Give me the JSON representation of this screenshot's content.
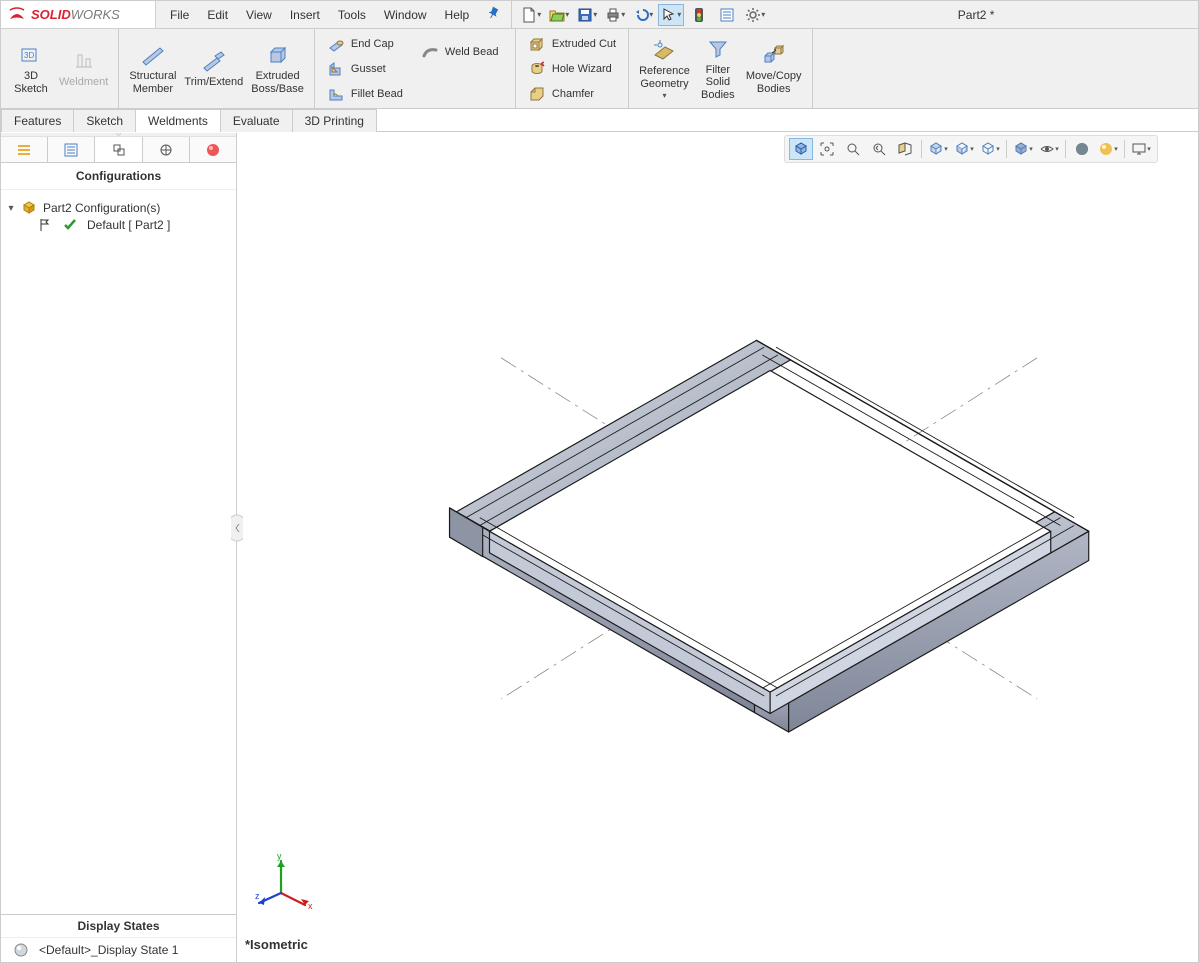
{
  "app": {
    "brand1": "SOLID",
    "brand2": "WORKS",
    "title": "Part2 *"
  },
  "menu": {
    "items": [
      "File",
      "Edit",
      "View",
      "Insert",
      "Tools",
      "Window",
      "Help"
    ]
  },
  "ribbon": {
    "group1": {
      "sketch3d": "3D\nSketch",
      "weldment": "Weldment",
      "structural_member": "Structural\nMember",
      "trim_extend": "Trim/Extend",
      "extruded_boss": "Extruded\nBoss/Base"
    },
    "group2": {
      "end_cap": "End Cap",
      "gusset": "Gusset",
      "fillet_bead": "Fillet Bead",
      "weld_bead": "Weld Bead"
    },
    "group3": {
      "extruded_cut": "Extruded Cut",
      "hole_wizard": "Hole Wizard",
      "chamfer": "Chamfer"
    },
    "group4": {
      "reference_geometry": "Reference\nGeometry",
      "filter_solid": "Filter\nSolid\nBodies",
      "move_copy": "Move/Copy\nBodies"
    }
  },
  "tabs": {
    "items": [
      "Features",
      "Sketch",
      "Weldments",
      "Evaluate",
      "3D Printing"
    ],
    "active_index": 2
  },
  "left_panel": {
    "header": "Configurations",
    "root": "Part2 Configuration(s)",
    "child": "Default [ Part2 ]",
    "display_states_hdr": "Display States",
    "display_state": "<Default>_Display State 1"
  },
  "viewport": {
    "view_label": "*Isometric",
    "axes": {
      "x": "x",
      "y": "y",
      "z": "z"
    }
  }
}
